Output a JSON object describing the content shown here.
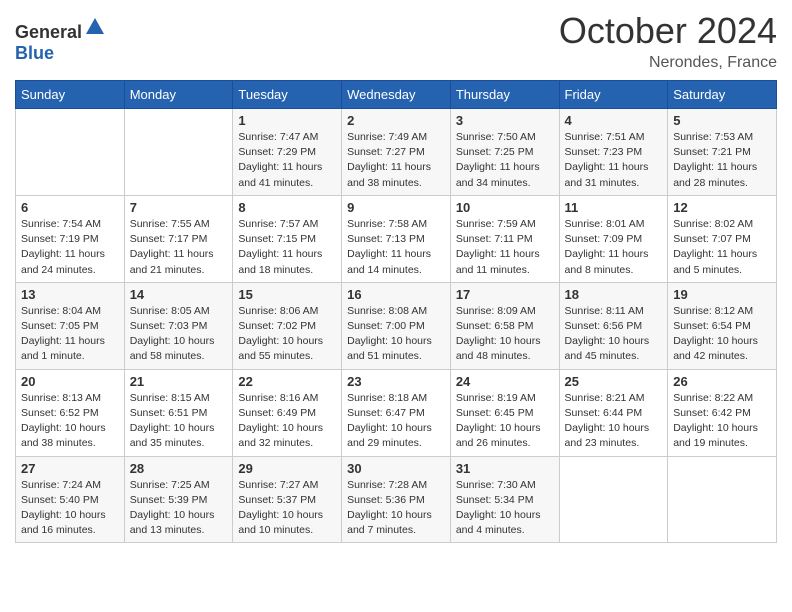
{
  "header": {
    "logo_general": "General",
    "logo_blue": "Blue",
    "month": "October 2024",
    "location": "Nerondes, France"
  },
  "days_of_week": [
    "Sunday",
    "Monday",
    "Tuesday",
    "Wednesday",
    "Thursday",
    "Friday",
    "Saturday"
  ],
  "weeks": [
    [
      {
        "day": "",
        "sunrise": "",
        "sunset": "",
        "daylight": ""
      },
      {
        "day": "",
        "sunrise": "",
        "sunset": "",
        "daylight": ""
      },
      {
        "day": "1",
        "sunrise": "Sunrise: 7:47 AM",
        "sunset": "Sunset: 7:29 PM",
        "daylight": "Daylight: 11 hours and 41 minutes."
      },
      {
        "day": "2",
        "sunrise": "Sunrise: 7:49 AM",
        "sunset": "Sunset: 7:27 PM",
        "daylight": "Daylight: 11 hours and 38 minutes."
      },
      {
        "day": "3",
        "sunrise": "Sunrise: 7:50 AM",
        "sunset": "Sunset: 7:25 PM",
        "daylight": "Daylight: 11 hours and 34 minutes."
      },
      {
        "day": "4",
        "sunrise": "Sunrise: 7:51 AM",
        "sunset": "Sunset: 7:23 PM",
        "daylight": "Daylight: 11 hours and 31 minutes."
      },
      {
        "day": "5",
        "sunrise": "Sunrise: 7:53 AM",
        "sunset": "Sunset: 7:21 PM",
        "daylight": "Daylight: 11 hours and 28 minutes."
      }
    ],
    [
      {
        "day": "6",
        "sunrise": "Sunrise: 7:54 AM",
        "sunset": "Sunset: 7:19 PM",
        "daylight": "Daylight: 11 hours and 24 minutes."
      },
      {
        "day": "7",
        "sunrise": "Sunrise: 7:55 AM",
        "sunset": "Sunset: 7:17 PM",
        "daylight": "Daylight: 11 hours and 21 minutes."
      },
      {
        "day": "8",
        "sunrise": "Sunrise: 7:57 AM",
        "sunset": "Sunset: 7:15 PM",
        "daylight": "Daylight: 11 hours and 18 minutes."
      },
      {
        "day": "9",
        "sunrise": "Sunrise: 7:58 AM",
        "sunset": "Sunset: 7:13 PM",
        "daylight": "Daylight: 11 hours and 14 minutes."
      },
      {
        "day": "10",
        "sunrise": "Sunrise: 7:59 AM",
        "sunset": "Sunset: 7:11 PM",
        "daylight": "Daylight: 11 hours and 11 minutes."
      },
      {
        "day": "11",
        "sunrise": "Sunrise: 8:01 AM",
        "sunset": "Sunset: 7:09 PM",
        "daylight": "Daylight: 11 hours and 8 minutes."
      },
      {
        "day": "12",
        "sunrise": "Sunrise: 8:02 AM",
        "sunset": "Sunset: 7:07 PM",
        "daylight": "Daylight: 11 hours and 5 minutes."
      }
    ],
    [
      {
        "day": "13",
        "sunrise": "Sunrise: 8:04 AM",
        "sunset": "Sunset: 7:05 PM",
        "daylight": "Daylight: 11 hours and 1 minute."
      },
      {
        "day": "14",
        "sunrise": "Sunrise: 8:05 AM",
        "sunset": "Sunset: 7:03 PM",
        "daylight": "Daylight: 10 hours and 58 minutes."
      },
      {
        "day": "15",
        "sunrise": "Sunrise: 8:06 AM",
        "sunset": "Sunset: 7:02 PM",
        "daylight": "Daylight: 10 hours and 55 minutes."
      },
      {
        "day": "16",
        "sunrise": "Sunrise: 8:08 AM",
        "sunset": "Sunset: 7:00 PM",
        "daylight": "Daylight: 10 hours and 51 minutes."
      },
      {
        "day": "17",
        "sunrise": "Sunrise: 8:09 AM",
        "sunset": "Sunset: 6:58 PM",
        "daylight": "Daylight: 10 hours and 48 minutes."
      },
      {
        "day": "18",
        "sunrise": "Sunrise: 8:11 AM",
        "sunset": "Sunset: 6:56 PM",
        "daylight": "Daylight: 10 hours and 45 minutes."
      },
      {
        "day": "19",
        "sunrise": "Sunrise: 8:12 AM",
        "sunset": "Sunset: 6:54 PM",
        "daylight": "Daylight: 10 hours and 42 minutes."
      }
    ],
    [
      {
        "day": "20",
        "sunrise": "Sunrise: 8:13 AM",
        "sunset": "Sunset: 6:52 PM",
        "daylight": "Daylight: 10 hours and 38 minutes."
      },
      {
        "day": "21",
        "sunrise": "Sunrise: 8:15 AM",
        "sunset": "Sunset: 6:51 PM",
        "daylight": "Daylight: 10 hours and 35 minutes."
      },
      {
        "day": "22",
        "sunrise": "Sunrise: 8:16 AM",
        "sunset": "Sunset: 6:49 PM",
        "daylight": "Daylight: 10 hours and 32 minutes."
      },
      {
        "day": "23",
        "sunrise": "Sunrise: 8:18 AM",
        "sunset": "Sunset: 6:47 PM",
        "daylight": "Daylight: 10 hours and 29 minutes."
      },
      {
        "day": "24",
        "sunrise": "Sunrise: 8:19 AM",
        "sunset": "Sunset: 6:45 PM",
        "daylight": "Daylight: 10 hours and 26 minutes."
      },
      {
        "day": "25",
        "sunrise": "Sunrise: 8:21 AM",
        "sunset": "Sunset: 6:44 PM",
        "daylight": "Daylight: 10 hours and 23 minutes."
      },
      {
        "day": "26",
        "sunrise": "Sunrise: 8:22 AM",
        "sunset": "Sunset: 6:42 PM",
        "daylight": "Daylight: 10 hours and 19 minutes."
      }
    ],
    [
      {
        "day": "27",
        "sunrise": "Sunrise: 7:24 AM",
        "sunset": "Sunset: 5:40 PM",
        "daylight": "Daylight: 10 hours and 16 minutes."
      },
      {
        "day": "28",
        "sunrise": "Sunrise: 7:25 AM",
        "sunset": "Sunset: 5:39 PM",
        "daylight": "Daylight: 10 hours and 13 minutes."
      },
      {
        "day": "29",
        "sunrise": "Sunrise: 7:27 AM",
        "sunset": "Sunset: 5:37 PM",
        "daylight": "Daylight: 10 hours and 10 minutes."
      },
      {
        "day": "30",
        "sunrise": "Sunrise: 7:28 AM",
        "sunset": "Sunset: 5:36 PM",
        "daylight": "Daylight: 10 hours and 7 minutes."
      },
      {
        "day": "31",
        "sunrise": "Sunrise: 7:30 AM",
        "sunset": "Sunset: 5:34 PM",
        "daylight": "Daylight: 10 hours and 4 minutes."
      },
      {
        "day": "",
        "sunrise": "",
        "sunset": "",
        "daylight": ""
      },
      {
        "day": "",
        "sunrise": "",
        "sunset": "",
        "daylight": ""
      }
    ]
  ]
}
